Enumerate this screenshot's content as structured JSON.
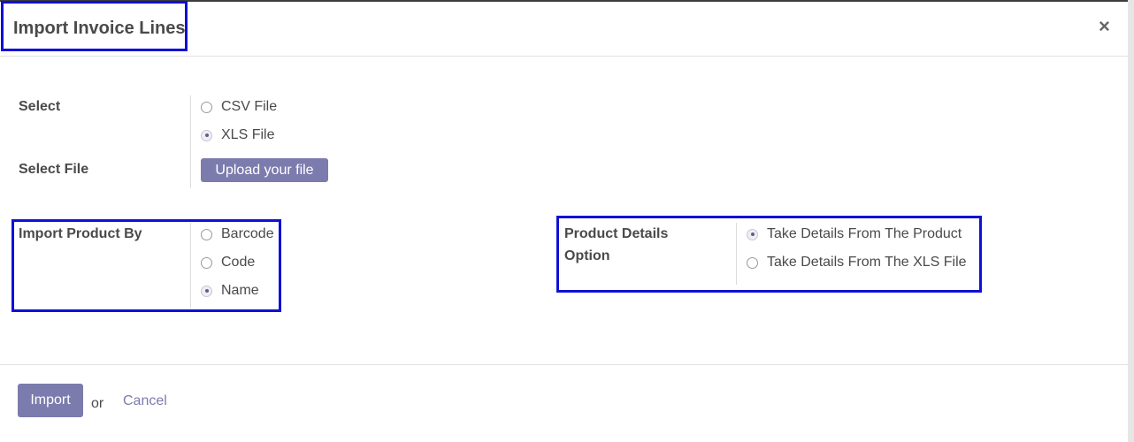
{
  "dialog": {
    "title": "Import Invoice Lines",
    "close_label": "×"
  },
  "select": {
    "label": "Select",
    "options": [
      {
        "label": "CSV File",
        "checked": false
      },
      {
        "label": "XLS File",
        "checked": true
      }
    ]
  },
  "select_file": {
    "label": "Select File",
    "button_label": "Upload your file"
  },
  "import_product_by": {
    "label": "Import Product By",
    "options": [
      {
        "label": "Barcode",
        "checked": false
      },
      {
        "label": "Code",
        "checked": false
      },
      {
        "label": "Name",
        "checked": true
      }
    ]
  },
  "product_details_option": {
    "label_line1": "Product Details",
    "label_line2": "Option",
    "options": [
      {
        "label": "Take Details From The Product",
        "checked": true
      },
      {
        "label": "Take Details From The XLS File",
        "checked": false
      }
    ]
  },
  "footer": {
    "import_label": "Import",
    "or_label": "or",
    "cancel_label": "Cancel"
  },
  "colors": {
    "primary": "#7c7bad",
    "highlight": "#1010d4"
  }
}
